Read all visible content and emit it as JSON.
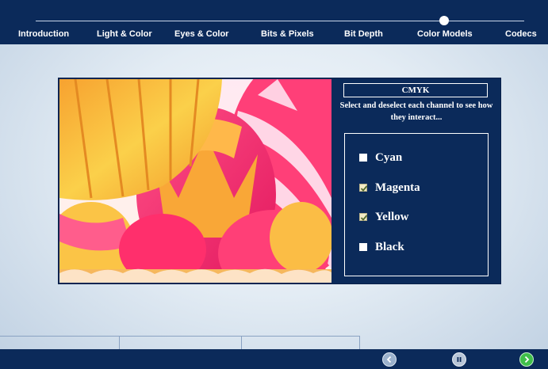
{
  "nav": {
    "items": [
      {
        "label": "Introduction"
      },
      {
        "label": "Light & Color"
      },
      {
        "label": "Eyes & Color"
      },
      {
        "label": "Bits & Pixels"
      },
      {
        "label": "Bit Depth"
      },
      {
        "label": "Color Models",
        "active": true
      },
      {
        "label": "Codecs"
      }
    ],
    "progress_step": 6,
    "progress_total": 7
  },
  "panel": {
    "title": "CMYK",
    "instruction": "Select and deselect each channel to see how they interact...",
    "channels": [
      {
        "label": "Cyan",
        "checked": false
      },
      {
        "label": "Magenta",
        "checked": true
      },
      {
        "label": "Yellow",
        "checked": true
      },
      {
        "label": "Black",
        "checked": false
      }
    ]
  },
  "controls": {
    "prev_icon": "chevron-left-icon",
    "pause_icon": "pause-icon",
    "next_icon": "chevron-right-icon"
  },
  "colors": {
    "navy": "#0b2a5a",
    "next_green": "#3fbf4a"
  }
}
